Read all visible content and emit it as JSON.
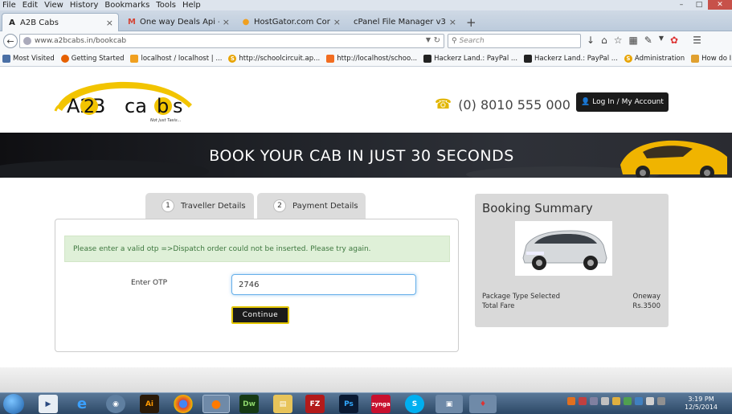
{
  "menubar": {
    "items": [
      "File",
      "Edit",
      "View",
      "History",
      "Bookmarks",
      "Tools",
      "Help"
    ]
  },
  "tabs": [
    {
      "title": "A2B Cabs",
      "icon": "a2b-favicon",
      "active": true
    },
    {
      "title": "One way Deals Api - Add P...",
      "icon": "gmail-icon"
    },
    {
      "title": "HostGator.com Control Pa...",
      "icon": "hostgator-icon"
    },
    {
      "title": "cPanel File Manager v3",
      "icon": ""
    }
  ],
  "nav": {
    "url": "www.a2bcabs.in/bookcab",
    "search_placeholder": "Search"
  },
  "bookmarks": [
    {
      "label": "Most Visited",
      "icon": "bookmarks-icon",
      "color": "#4a6fa5"
    },
    {
      "label": "Getting Started",
      "icon": "firefox-icon",
      "color": "#e66000"
    },
    {
      "label": "localhost / localhost | ...",
      "icon": "pma-icon",
      "color": "#f0a020"
    },
    {
      "label": "http://schoolcircuit.ap...",
      "icon": "s-icon",
      "color": "#e8a400"
    },
    {
      "label": "http://localhost/schoo...",
      "icon": "xampp-icon",
      "color": "#f26d21"
    },
    {
      "label": "Hackerz Land.: PayPal ...",
      "icon": "hackerz-icon",
      "color": "#222222"
    },
    {
      "label": "Hackerz Land.: PayPal ...",
      "icon": "hackerz-icon",
      "color": "#222222"
    },
    {
      "label": "Administration",
      "icon": "s-icon",
      "color": "#e8a400"
    },
    {
      "label": "How do I pass an extra...",
      "icon": "page-icon",
      "color": "#e0a030"
    }
  ],
  "header": {
    "logo_main_left": "A2B",
    "logo_main_right": "cabs",
    "logo_tagline": "Not just Taxis...",
    "phone": "(0) 8010 555 000",
    "login_label": "Log In",
    "separator": "/",
    "account_label": "My Account"
  },
  "banner": {
    "title": "BOOK YOUR CAB IN JUST 30 SECONDS"
  },
  "steps": [
    {
      "num": "1",
      "label": "Traveller Details"
    },
    {
      "num": "2",
      "label": "Payment Details"
    }
  ],
  "form": {
    "alert": "Please enter a valid otp =>Dispatch order could not be inserted. Please try again.",
    "otp_label": "Enter OTP",
    "otp_value": "2746",
    "continue_label": "Continue"
  },
  "summary": {
    "title": "Booking Summary",
    "package_label": "Package Type Selected",
    "package_value": "Oneway",
    "fare_label": "Total Fare",
    "fare_value": "Rs.3500"
  },
  "taskbar": {
    "apps": [
      "Ai",
      "Dw",
      "FZ",
      "Ps",
      "zynga"
    ],
    "time": "3:19 PM",
    "date": "12/5/2014"
  },
  "colors": {
    "accent_yellow": "#e2c500",
    "dark": "#1b1b1b",
    "alert_bg": "#dff0d8",
    "alert_text": "#3c763d"
  }
}
